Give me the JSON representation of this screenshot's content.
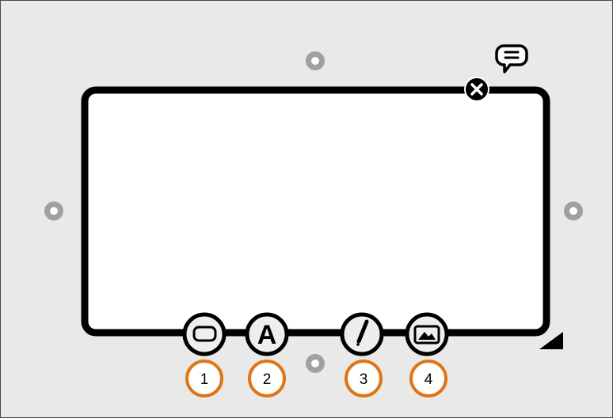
{
  "colors": {
    "background": "#e9e9e9",
    "border": "#4a4a4a",
    "shape_fill": "#ffffff",
    "shape_stroke": "#000000",
    "handle": "#9e9e9e",
    "callout_stroke": "#e07416",
    "tool_button_fill": "#eeeeee"
  },
  "icons": {
    "comment": "speech-bubble-icon",
    "delete": "close-icon",
    "resize": "resize-triangle-icon",
    "tools": [
      "rounded-rect-shape-icon",
      "font-A-icon",
      "pencil-icon",
      "image-icon"
    ]
  },
  "tool_letter": "A",
  "callouts": [
    {
      "number": "1"
    },
    {
      "number": "2"
    },
    {
      "number": "3"
    },
    {
      "number": "4"
    }
  ]
}
